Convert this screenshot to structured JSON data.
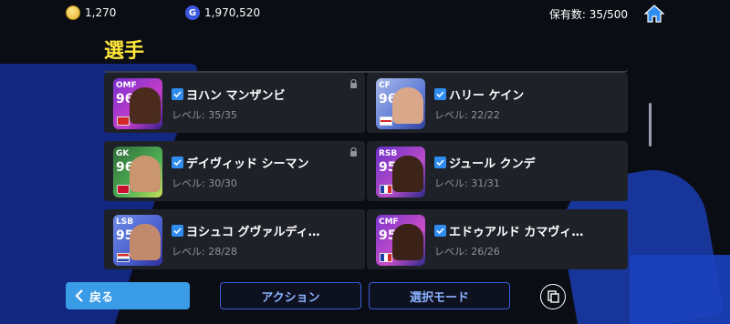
{
  "topbar": {
    "coins": "1,270",
    "gp_letter": "G",
    "gp": "1,970,520",
    "holding": "保有数: 35/500"
  },
  "title": "選手",
  "players": [
    {
      "pos": "OMF",
      "ovr": "96",
      "name": "ヨハン マンザンビ",
      "level": "レベル: 35/35",
      "locked": true
    },
    {
      "pos": "CF",
      "ovr": "96",
      "name": "ハリー ケイン",
      "level": "レベル: 22/22",
      "locked": false
    },
    {
      "pos": "GK",
      "ovr": "96",
      "name": "デイヴィッド シーマン",
      "level": "レベル: 30/30",
      "locked": true
    },
    {
      "pos": "RSB",
      "ovr": "95",
      "name": "ジュール クンデ",
      "level": "レベル: 31/31",
      "locked": false
    },
    {
      "pos": "LSB",
      "ovr": "95",
      "name": "ヨシュコ グヴァルディ…",
      "level": "レベル: 28/28",
      "locked": false
    },
    {
      "pos": "CMF",
      "ovr": "95",
      "name": "エドゥアルド カマヴィ…",
      "level": "レベル: 26/26",
      "locked": false
    }
  ],
  "buttons": {
    "back": "戻る",
    "action": "アクション",
    "select_mode": "選択モード"
  },
  "colors": {
    "title": "#ffe83a",
    "accent_blue": "#3a9be6",
    "check_blue": "#2f8df0"
  }
}
